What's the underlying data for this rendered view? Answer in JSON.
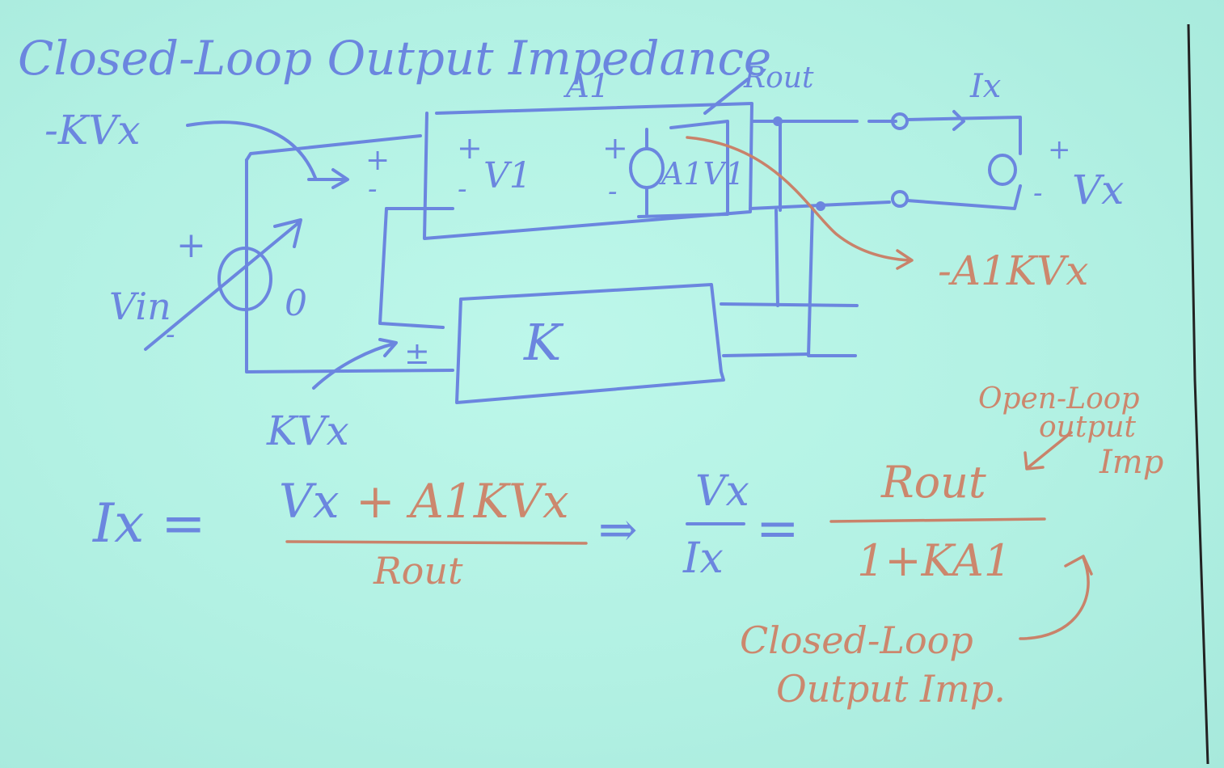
{
  "title": "Closed-Loop Output Impedance",
  "colors": {
    "board": "#b2f0e2",
    "blue_ink": "#6b86df",
    "red_ink": "#cc876d"
  },
  "labels": {
    "kvx_top": "-KVx",
    "a1": "A1",
    "rout": "Rout",
    "ix": "Ix",
    "plus": "+",
    "minus": "-",
    "pm": "±",
    "v1": "V1",
    "a1v1": "A1V1",
    "vx": "Vx",
    "neg_a1kvx": "-A1KVx",
    "vin": "Vin",
    "zero": "0",
    "k": "K",
    "kvx_bottom": "KVx"
  },
  "equation": {
    "lhs": "Ix =",
    "num_blue": "Vx",
    "num_red": "+ A1KVx",
    "den": "Rout",
    "implies": "⇒",
    "ratio_num": "Vx",
    "ratio_den": "Ix",
    "equals": "=",
    "rhs_num": "Rout",
    "rhs_den": "1+KA1"
  },
  "annotations": {
    "open_loop_1": "Open-Loop",
    "open_loop_2": "output",
    "open_loop_3": "Imp",
    "closed_loop_1": "Closed-Loop",
    "closed_loop_2": "Output Imp."
  }
}
